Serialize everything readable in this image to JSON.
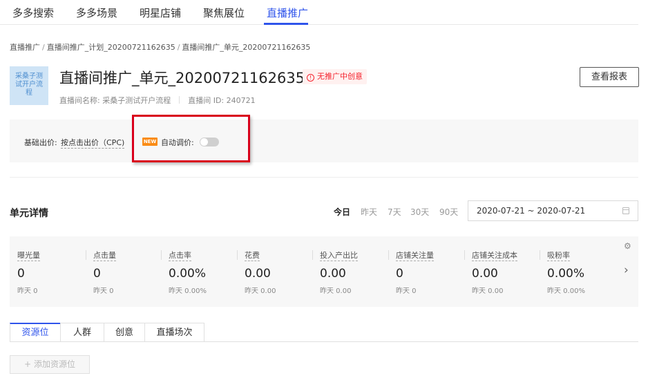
{
  "nav": {
    "tabs": [
      "多多搜索",
      "多多场景",
      "明星店铺",
      "聚焦展位",
      "直播推广"
    ],
    "active_index": 4
  },
  "breadcrumb": [
    "直播推广",
    "直播间推广_计划_20200721162635",
    "直播间推广_单元_20200721162635"
  ],
  "breadcrumb_sep": "/",
  "unit": {
    "thumbnail_text": "采桑子测试开户流程",
    "title": "直播间推广_单元_20200721162635",
    "status": "无推广中创意",
    "status_icon": "!",
    "live_room_name": "直播间名称: 采桑子测试开户流程",
    "live_room_id": "直播间 ID: 240721",
    "report_button": "查看报表"
  },
  "bidding": {
    "base_label": "基础出价:",
    "base_value": "按点击出价（CPC)",
    "new_badge": "NEW",
    "auto_label": "自动调价:",
    "auto_enabled": false
  },
  "details": {
    "title": "单元详情",
    "ranges": [
      "今日",
      "昨天",
      "7天",
      "30天",
      "90天"
    ],
    "active_range": 0,
    "date_range": "2020-07-21 ~ 2020-07-21"
  },
  "metrics": [
    {
      "label": "曝光量",
      "value": "0",
      "prev": "昨天 0"
    },
    {
      "label": "点击量",
      "value": "0",
      "prev": "昨天 0"
    },
    {
      "label": "点击率",
      "value": "0.00%",
      "prev": "昨天 0.00%"
    },
    {
      "label": "花费",
      "value": "0.00",
      "prev": "昨天 0.00"
    },
    {
      "label": "投入产出比",
      "value": "0.00",
      "prev": "昨天 0.00"
    },
    {
      "label": "店铺关注量",
      "value": "0",
      "prev": "昨天 0"
    },
    {
      "label": "店铺关注成本",
      "value": "0.00",
      "prev": "昨天 0.00"
    },
    {
      "label": "吸粉率",
      "value": "0.00%",
      "prev": "昨天 0.00%"
    }
  ],
  "subtabs": [
    "资源位",
    "人群",
    "创意",
    "直播场次"
  ],
  "active_subtab": 0,
  "add_button": "添加资源位",
  "add_icon": "+",
  "gear_icon": "⚙",
  "chevron_icon": "›",
  "colors": {
    "accent": "#2f54eb",
    "warning": "#f5222d",
    "highlight": "#d9001b",
    "new_badge": "#fa8c16"
  }
}
